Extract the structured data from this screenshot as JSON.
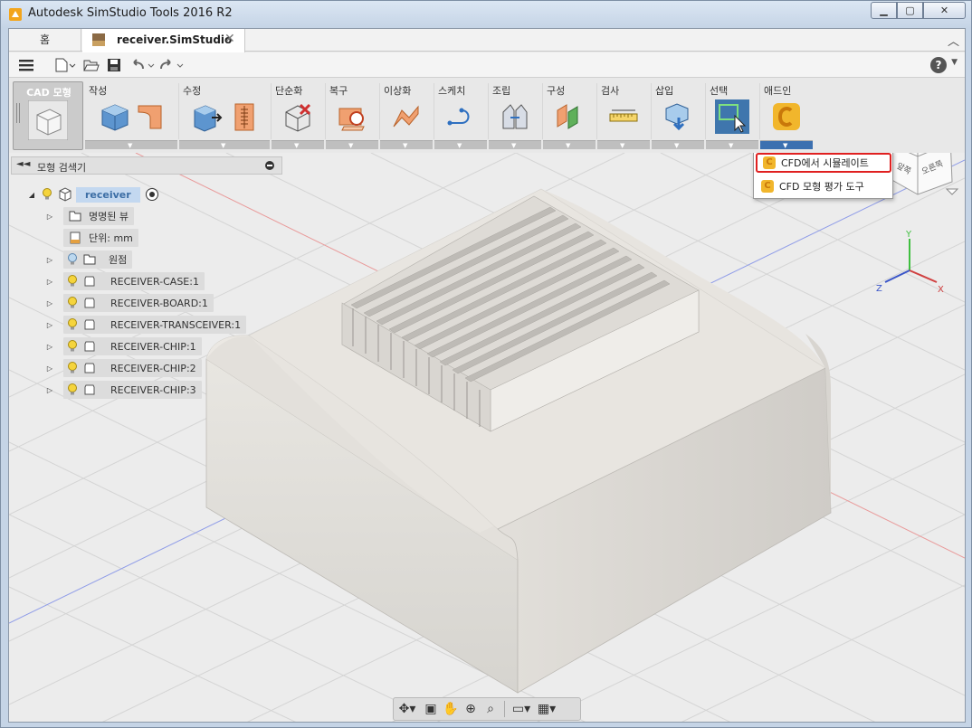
{
  "window": {
    "title": "Autodesk SimStudio Tools 2016 R2"
  },
  "tabs": {
    "home": "홈",
    "document": "receiver.SimStudio"
  },
  "ribbon": {
    "workspace_label": "CAD 모형",
    "groups": [
      {
        "label": "작성"
      },
      {
        "label": "수정"
      },
      {
        "label": "단순화"
      },
      {
        "label": "복구"
      },
      {
        "label": "이상화"
      },
      {
        "label": "스케치"
      },
      {
        "label": "조립"
      },
      {
        "label": "구성"
      },
      {
        "label": "검사"
      },
      {
        "label": "삽입"
      },
      {
        "label": "선택"
      },
      {
        "label": "애드인"
      }
    ]
  },
  "addin_menu": {
    "items": [
      {
        "label": "CFD에서 시뮬레이트",
        "highlighted": true
      },
      {
        "label": "CFD 모형 평가 도구",
        "highlighted": false
      }
    ]
  },
  "browser": {
    "title": "모형 검색기",
    "root": "receiver",
    "items": [
      {
        "label": "명명된 뷰"
      },
      {
        "label": "단위: mm"
      },
      {
        "label": "원점"
      },
      {
        "label": "RECEIVER-CASE:1"
      },
      {
        "label": "RECEIVER-BOARD:1"
      },
      {
        "label": "RECEIVER-TRANSCEIVER:1"
      },
      {
        "label": "RECEIVER-CHIP:1"
      },
      {
        "label": "RECEIVER-CHIP:2"
      },
      {
        "label": "RECEIVER-CHIP:3"
      }
    ]
  },
  "viewcube": {
    "faces": [
      "앞쪽",
      "오른쪽"
    ]
  },
  "triad": {
    "x": "X",
    "y": "Y",
    "z": "Z"
  },
  "colors": {
    "highlight_border": "#e02020",
    "model_body": "#e4e2dd",
    "grid_line": "#d2d2d2",
    "axis_red": "#e06060",
    "axis_blue": "#6b7fe0"
  }
}
